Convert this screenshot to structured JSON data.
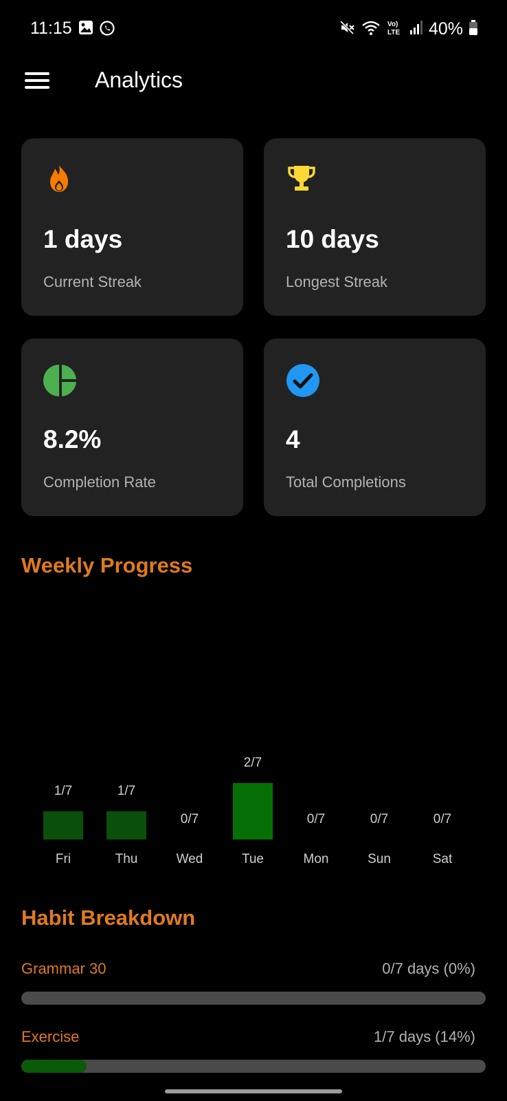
{
  "status_bar": {
    "time": "11:15",
    "battery": "40%",
    "icons": [
      "gallery-icon",
      "whatsapp-icon",
      "mute-icon",
      "wifi-icon",
      "volte-icon",
      "signal-icon",
      "battery-icon"
    ]
  },
  "app_bar": {
    "title": "Analytics",
    "menu_icon": "hamburger-menu-icon"
  },
  "stats": [
    {
      "icon": "flame-icon",
      "value": "1 days",
      "label": "Current Streak",
      "color": "#F57C00"
    },
    {
      "icon": "trophy-icon",
      "value": "10 days",
      "label": "Longest Streak",
      "color": "#FDD835"
    },
    {
      "icon": "pie-chart-icon",
      "value": "8.2%",
      "label": "Completion Rate",
      "color": "#4CAF50"
    },
    {
      "icon": "check-circle-icon",
      "value": "4",
      "label": "Total Completions",
      "color": "#2196F3"
    }
  ],
  "weekly_progress": {
    "title": "Weekly Progress",
    "chart_data": {
      "type": "bar",
      "categories": [
        "Fri",
        "Thu",
        "Wed",
        "Tue",
        "Mon",
        "Sun",
        "Sat"
      ],
      "values": [
        1,
        1,
        0,
        2,
        0,
        0,
        0
      ],
      "max": 7,
      "labels": [
        "1/7",
        "1/7",
        "0/7",
        "2/7",
        "0/7",
        "0/7",
        "0/7"
      ]
    }
  },
  "habit_breakdown": {
    "title": "Habit Breakdown",
    "habits": [
      {
        "name": "Grammar 30",
        "stat": "0/7 days (0%)",
        "progress": 0.0
      },
      {
        "name": "Exercise",
        "stat": "1/7 days (14%)",
        "progress": 0.14
      }
    ]
  },
  "colors": {
    "accent": "#E07A1F",
    "card": "#222222",
    "bar_dark": "#0A4F0A",
    "bar_bright": "#067006"
  }
}
